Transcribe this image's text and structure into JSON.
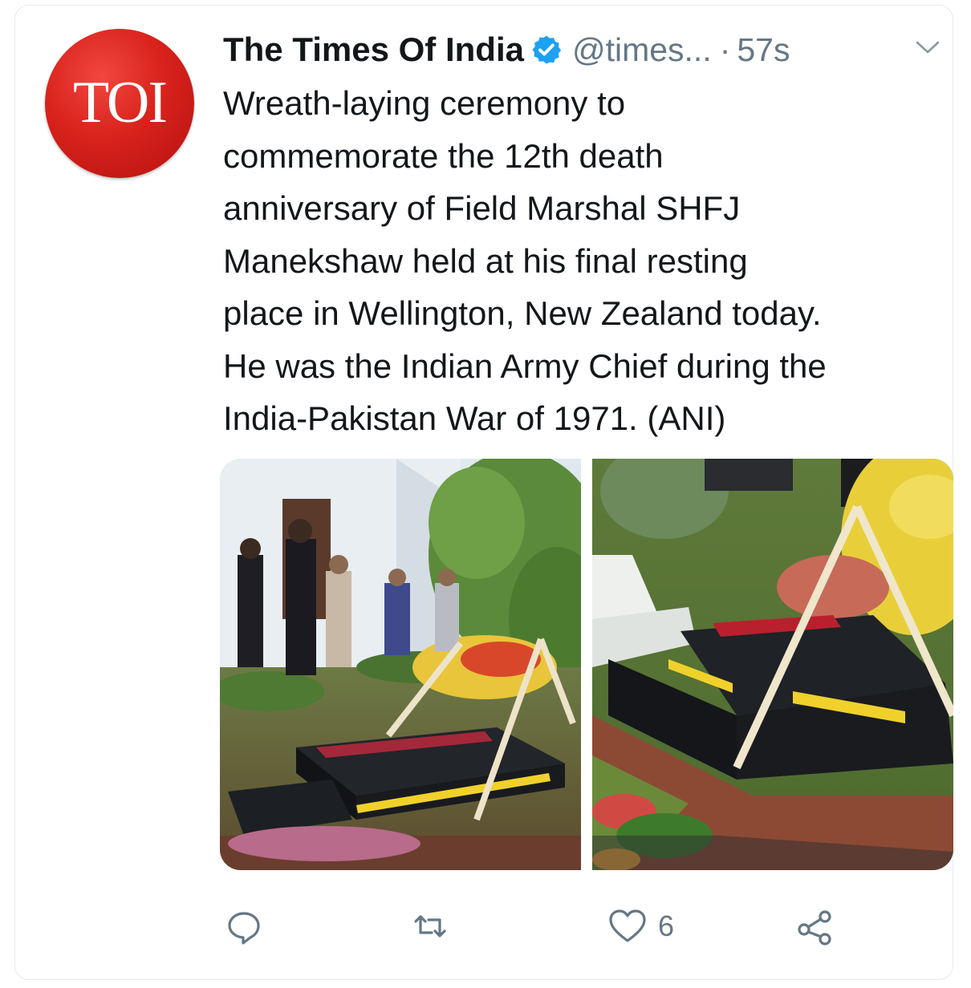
{
  "tweet": {
    "author": {
      "name": "The Times Of India",
      "handle": "@times...",
      "avatar_text": "TOI",
      "verified": true
    },
    "separator": "·",
    "timestamp": "57s",
    "text_lines": [
      "Wreath-laying ceremony to",
      "commemorate the 12th death",
      "anniversary of Field Marshal SHFJ",
      "Manekshaw held at his final resting",
      "place in Wellington, New Zealand today.",
      "He was the Indian Army Chief during the",
      "India-Pakistan War of 1971. (ANI)"
    ],
    "media": [
      {
        "icon": "photo-ceremony"
      },
      {
        "icon": "photo-grave"
      }
    ],
    "actions": {
      "reply_icon": "reply-icon",
      "retweet_icon": "retweet-icon",
      "like_icon": "heart-icon",
      "like_count": "6",
      "share_icon": "share-icon"
    },
    "colors": {
      "brand_red": "#d9221c",
      "verified_blue": "#1da1f2",
      "secondary_text": "#657786",
      "primary_text": "#14171a"
    }
  }
}
